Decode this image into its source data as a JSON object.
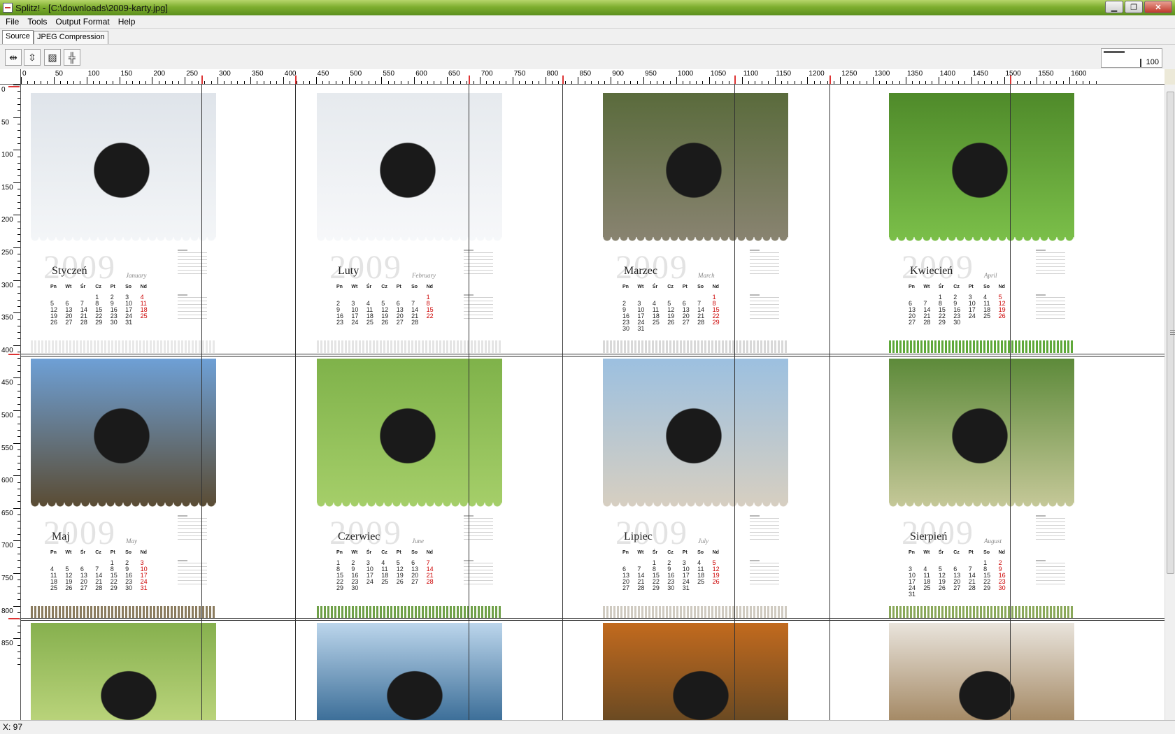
{
  "window": {
    "title": "Splitz! - [C:\\downloads\\2009-karty.jpg]"
  },
  "menu": [
    "File",
    "Tools",
    "Output Format",
    "Help"
  ],
  "tabs": [
    "Source",
    "JPEG Compression"
  ],
  "toolbar": {
    "zoom_value": "100"
  },
  "ruler_h": [
    "0",
    "50",
    "100",
    "150",
    "200",
    "250",
    "300",
    "350",
    "400",
    "450",
    "500",
    "550",
    "600",
    "650",
    "700",
    "750",
    "800",
    "850",
    "900",
    "950",
    "1000",
    "1050",
    "1100",
    "1150",
    "1200",
    "1250",
    "1300",
    "1350",
    "1400",
    "1450",
    "1500",
    "1550",
    "1600"
  ],
  "ruler_v": [
    "0",
    "50",
    "100",
    "150",
    "200",
    "250",
    "300",
    "350",
    "400",
    "450",
    "500",
    "550",
    "600",
    "650",
    "700",
    "750",
    "800",
    "850"
  ],
  "year_text": "2009",
  "weekday_headers": [
    "Pn",
    "Wt",
    "Śr",
    "Cz",
    "Pt",
    "So",
    "Nd"
  ],
  "cards": [
    {
      "month_pl": "Styczeń",
      "month_en": "January",
      "photo": "#dfe4ea",
      "photo2": "#f4f6f8",
      "strip": "#e8e8e8",
      "days": [
        "",
        "",
        "",
        "1",
        "2",
        "3",
        "4",
        "5",
        "6",
        "7",
        "8",
        "9",
        "10",
        "11",
        "12",
        "13",
        "14",
        "15",
        "16",
        "17",
        "18",
        "19",
        "20",
        "21",
        "22",
        "23",
        "24",
        "25",
        "26",
        "27",
        "28",
        "29",
        "30",
        "31"
      ]
    },
    {
      "month_pl": "Luty",
      "month_en": "February",
      "photo": "#e6eaee",
      "photo2": "#f7f8fa",
      "strip": "#e4e4e4",
      "days": [
        "",
        "",
        "",
        "",
        "",
        "",
        "1",
        "2",
        "3",
        "4",
        "5",
        "6",
        "7",
        "8",
        "9",
        "10",
        "11",
        "12",
        "13",
        "14",
        "15",
        "16",
        "17",
        "18",
        "19",
        "20",
        "21",
        "22",
        "23",
        "24",
        "25",
        "26",
        "27",
        "28"
      ]
    },
    {
      "month_pl": "Marzec",
      "month_en": "March",
      "photo": "#5a6b3c",
      "photo2": "#8a8472",
      "strip": "#d8d8d8",
      "days": [
        "",
        "",
        "",
        "",
        "",
        "",
        "1",
        "2",
        "3",
        "4",
        "5",
        "6",
        "7",
        "8",
        "9",
        "10",
        "11",
        "12",
        "13",
        "14",
        "15",
        "16",
        "17",
        "18",
        "19",
        "20",
        "21",
        "22",
        "23",
        "24",
        "25",
        "26",
        "27",
        "28",
        "29",
        "30",
        "31"
      ]
    },
    {
      "month_pl": "Kwiecień",
      "month_en": "April",
      "photo": "#4f8a2a",
      "photo2": "#7cc04a",
      "strip": "#5fa83a",
      "days": [
        "",
        "",
        "1",
        "2",
        "3",
        "4",
        "5",
        "6",
        "7",
        "8",
        "9",
        "10",
        "11",
        "12",
        "13",
        "14",
        "15",
        "16",
        "17",
        "18",
        "19",
        "20",
        "21",
        "22",
        "23",
        "24",
        "25",
        "26",
        "27",
        "28",
        "29",
        "30"
      ]
    },
    {
      "month_pl": "Maj",
      "month_en": "May",
      "photo": "#6ea0d6",
      "photo2": "#5a4a30",
      "strip": "#8a7b5e",
      "days": [
        "",
        "",
        "",
        "",
        "1",
        "2",
        "3",
        "4",
        "5",
        "6",
        "7",
        "8",
        "9",
        "10",
        "11",
        "12",
        "13",
        "14",
        "15",
        "16",
        "17",
        "18",
        "19",
        "20",
        "21",
        "22",
        "23",
        "24",
        "25",
        "26",
        "27",
        "28",
        "29",
        "30",
        "31"
      ]
    },
    {
      "month_pl": "Czerwiec",
      "month_en": "June",
      "photo": "#7fb24a",
      "photo2": "#a6cf6a",
      "strip": "#6fa048",
      "days": [
        "1",
        "2",
        "3",
        "4",
        "5",
        "6",
        "7",
        "8",
        "9",
        "10",
        "11",
        "12",
        "13",
        "14",
        "15",
        "16",
        "17",
        "18",
        "19",
        "20",
        "21",
        "22",
        "23",
        "24",
        "25",
        "26",
        "27",
        "28",
        "29",
        "30"
      ]
    },
    {
      "month_pl": "Lipiec",
      "month_en": "July",
      "photo": "#9cc0e0",
      "photo2": "#d8cfc0",
      "strip": "#cfcac0",
      "days": [
        "",
        "",
        "1",
        "2",
        "3",
        "4",
        "5",
        "6",
        "7",
        "8",
        "9",
        "10",
        "11",
        "12",
        "13",
        "14",
        "15",
        "16",
        "17",
        "18",
        "19",
        "20",
        "21",
        "22",
        "23",
        "24",
        "25",
        "26",
        "27",
        "28",
        "29",
        "30",
        "31"
      ]
    },
    {
      "month_pl": "Sierpień",
      "month_en": "August",
      "photo": "#5d8a3a",
      "photo2": "#c7c99a",
      "strip": "#8aa85a",
      "days": [
        "",
        "",
        "",
        "",
        "",
        "1",
        "2",
        "3",
        "4",
        "5",
        "6",
        "7",
        "8",
        "9",
        "10",
        "11",
        "12",
        "13",
        "14",
        "15",
        "16",
        "17",
        "18",
        "19",
        "20",
        "21",
        "22",
        "23",
        "24",
        "25",
        "26",
        "27",
        "28",
        "29",
        "30",
        "31"
      ]
    }
  ],
  "bottom_cards": [
    {
      "photo": "#86b04e",
      "photo2": "#b9d37a"
    },
    {
      "photo": "#bcd6ec",
      "photo2": "#3d6f99"
    },
    {
      "photo": "#c26a1e",
      "photo2": "#6b4a22"
    },
    {
      "photo": "#e9e4dc",
      "photo2": "#a58a66"
    }
  ],
  "status": {
    "x_readout": "X: 97"
  }
}
